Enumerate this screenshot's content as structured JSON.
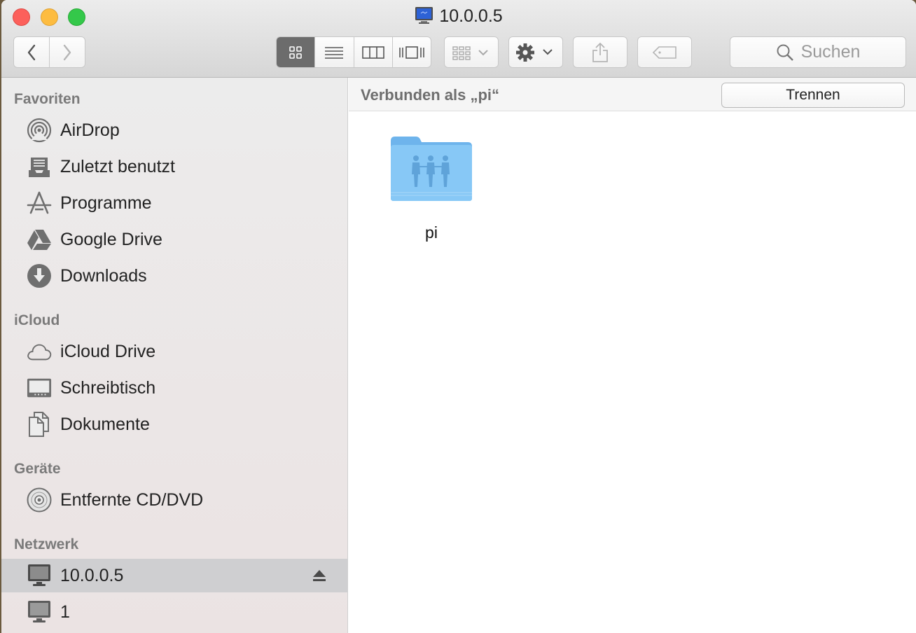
{
  "window": {
    "title": "10.0.0.5",
    "title_icon": "network-monitor-icon"
  },
  "toolbar": {
    "back_icon": "chevron-left-icon",
    "forward_icon": "chevron-right-icon",
    "views": [
      "icon-view-icon",
      "list-view-icon",
      "column-view-icon",
      "cover-flow-icon"
    ],
    "active_view": "icon-view-icon",
    "arrange_icon": "arrange-grid-icon",
    "action_icon": "gear-icon",
    "share_icon": "share-icon",
    "tag_icon": "tag-icon",
    "search_placeholder": "Suchen"
  },
  "sidebar": {
    "sections": [
      {
        "header": "Favoriten",
        "items": [
          {
            "label": "AirDrop",
            "icon": "airdrop-icon"
          },
          {
            "label": "Zuletzt benutzt",
            "icon": "recents-icon"
          },
          {
            "label": "Programme",
            "icon": "applications-icon"
          },
          {
            "label": "Google Drive",
            "icon": "google-drive-icon"
          },
          {
            "label": "Downloads",
            "icon": "downloads-icon"
          }
        ]
      },
      {
        "header": "iCloud",
        "items": [
          {
            "label": "iCloud Drive",
            "icon": "cloud-icon"
          },
          {
            "label": "Schreibtisch",
            "icon": "desktop-icon"
          },
          {
            "label": "Dokumente",
            "icon": "documents-icon"
          }
        ]
      },
      {
        "header": "Geräte",
        "items": [
          {
            "label": "Entfernte CD/DVD",
            "icon": "disc-icon"
          }
        ]
      },
      {
        "header": "Netzwerk",
        "items": [
          {
            "label": "10.0.0.5",
            "icon": "computer-icon",
            "selected": true,
            "eject": true
          },
          {
            "label": "1",
            "icon": "computer-icon"
          }
        ]
      }
    ]
  },
  "content": {
    "connected_label": "Verbunden als „pi“",
    "disconnect_button": "Trennen",
    "items": [
      {
        "name": "pi",
        "icon": "shared-folder-icon"
      }
    ]
  },
  "colors": {
    "close": "#fc605b",
    "minimize": "#fdbc40",
    "maximize": "#34c84a",
    "folder": "#7fc2f4",
    "selection": "#cfcfd1"
  }
}
